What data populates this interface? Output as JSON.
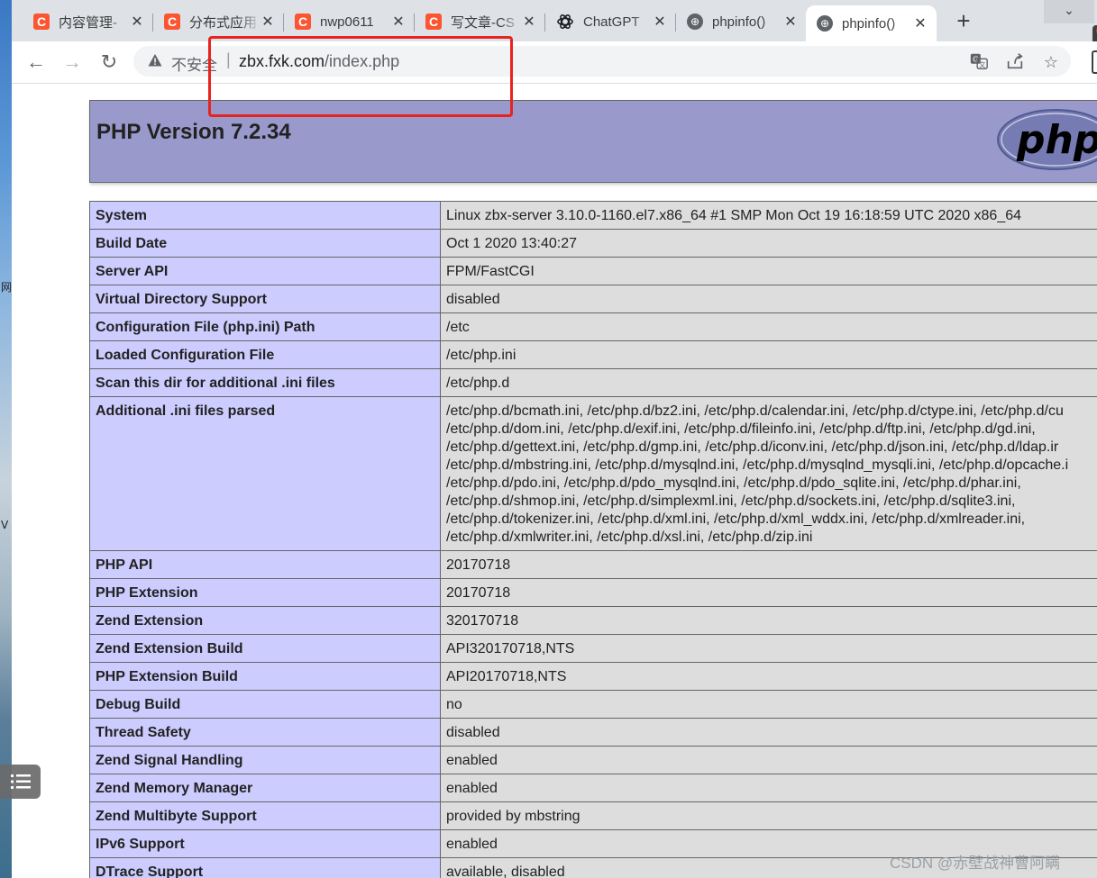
{
  "desktop": {
    "left_chars": [
      "网",
      "V"
    ]
  },
  "tabs": [
    {
      "title": "内容管理-",
      "favicon": "csdn-c",
      "close": "✕"
    },
    {
      "title": "分布式应用",
      "favicon": "csdn-c",
      "close": "✕"
    },
    {
      "title": "nwp0611",
      "favicon": "csdn-c",
      "close": "✕"
    },
    {
      "title": "写文章-CS",
      "favicon": "csdn-c",
      "close": "✕"
    },
    {
      "title": "ChatGPT",
      "favicon": "openai-logo",
      "close": "✕"
    },
    {
      "title": "phpinfo()",
      "favicon": "globe",
      "close": "✕"
    },
    {
      "title": "phpinfo()",
      "favicon": "globe",
      "close": "✕",
      "active": true
    }
  ],
  "new_tab": "+",
  "window_menu": "⌄",
  "omnibox": {
    "security_label": "不安全",
    "separator": "|",
    "url_host": "zbx.fxk.com",
    "url_path": "/index.php"
  },
  "php": {
    "title": "PHP Version 7.2.34",
    "logo_text": "php"
  },
  "info_rows": [
    {
      "key": "System",
      "value": "Linux zbx-server 3.10.0-1160.el7.x86_64 #1 SMP Mon Oct 19 16:18:59 UTC 2020 x86_64"
    },
    {
      "key": "Build Date",
      "value": "Oct 1 2020 13:40:27"
    },
    {
      "key": "Server API",
      "value": "FPM/FastCGI"
    },
    {
      "key": "Virtual Directory Support",
      "value": "disabled"
    },
    {
      "key": "Configuration File (php.ini) Path",
      "value": "/etc"
    },
    {
      "key": "Loaded Configuration File",
      "value": "/etc/php.ini"
    },
    {
      "key": "Scan this dir for additional .ini files",
      "value": "/etc/php.d"
    },
    {
      "key": "Additional .ini files parsed",
      "lines": [
        "/etc/php.d/bcmath.ini, /etc/php.d/bz2.ini, /etc/php.d/calendar.ini, /etc/php.d/ctype.ini, /etc/php.d/cu",
        "/etc/php.d/dom.ini, /etc/php.d/exif.ini, /etc/php.d/fileinfo.ini, /etc/php.d/ftp.ini, /etc/php.d/gd.ini,",
        "/etc/php.d/gettext.ini, /etc/php.d/gmp.ini, /etc/php.d/iconv.ini, /etc/php.d/json.ini, /etc/php.d/ldap.ir",
        "/etc/php.d/mbstring.ini, /etc/php.d/mysqlnd.ini, /etc/php.d/mysqlnd_mysqli.ini, /etc/php.d/opcache.i",
        "/etc/php.d/pdo.ini, /etc/php.d/pdo_mysqlnd.ini, /etc/php.d/pdo_sqlite.ini, /etc/php.d/phar.ini,",
        "/etc/php.d/shmop.ini, /etc/php.d/simplexml.ini, /etc/php.d/sockets.ini, /etc/php.d/sqlite3.ini,",
        "/etc/php.d/tokenizer.ini, /etc/php.d/xml.ini, /etc/php.d/xml_wddx.ini, /etc/php.d/xmlreader.ini,",
        "/etc/php.d/xmlwriter.ini, /etc/php.d/xsl.ini, /etc/php.d/zip.ini"
      ]
    },
    {
      "key": "PHP API",
      "value": "20170718"
    },
    {
      "key": "PHP Extension",
      "value": "20170718"
    },
    {
      "key": "Zend Extension",
      "value": "320170718"
    },
    {
      "key": "Zend Extension Build",
      "value": "API320170718,NTS"
    },
    {
      "key": "PHP Extension Build",
      "value": "API20170718,NTS"
    },
    {
      "key": "Debug Build",
      "value": "no"
    },
    {
      "key": "Thread Safety",
      "value": "disabled"
    },
    {
      "key": "Zend Signal Handling",
      "value": "enabled"
    },
    {
      "key": "Zend Memory Manager",
      "value": "enabled"
    },
    {
      "key": "Zend Multibyte Support",
      "value": "provided by mbstring"
    },
    {
      "key": "IPv6 Support",
      "value": "enabled"
    },
    {
      "key": "DTrace Support",
      "value": "available, disabled"
    }
  ],
  "overlay": {
    "side_button_icon": "list-icon",
    "watermark": "CSDN @赤壁战神曹阿瞒"
  },
  "colors": {
    "header_bg": "#9999cc",
    "key_cell_bg": "#ccccff",
    "value_cell_bg": "#dddddd",
    "highlight_box": "#e8231f",
    "csdn_favicon": "#fc5531"
  }
}
